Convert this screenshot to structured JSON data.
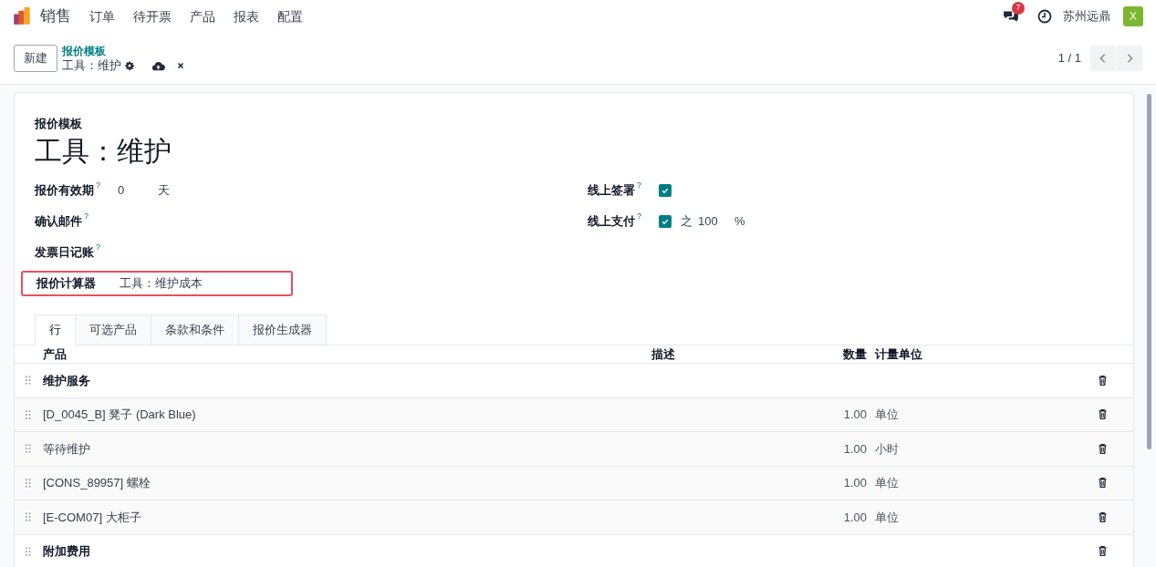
{
  "navbar": {
    "app": "销售",
    "menu": [
      "订单",
      "待开票",
      "产品",
      "报表",
      "配置"
    ],
    "message_count": "7",
    "company": "苏州远鼎",
    "avatar_letter": "X"
  },
  "control_panel": {
    "new_button": "新建",
    "breadcrumb": "报价模板",
    "record": "工具：维护",
    "pager": "1 / 1"
  },
  "form": {
    "caption": "报价模板",
    "title": "工具：维护",
    "left_fields": [
      {
        "label": "报价有效期",
        "help": "?",
        "value": "0",
        "unit": "天",
        "highlighted": false
      },
      {
        "label": "确认邮件",
        "help": "?",
        "highlighted": false
      },
      {
        "label": "发票日记账",
        "help": "?",
        "highlighted": false
      },
      {
        "label": "报价计算器",
        "value": "工具：维护成本",
        "highlighted": true
      }
    ],
    "right_fields": [
      {
        "label": "线上签署",
        "help": "?",
        "checked": true
      },
      {
        "label": "线上支付",
        "help": "?",
        "checked": true,
        "prefix": "之",
        "value": "100",
        "unit": "%"
      }
    ],
    "tabs": [
      {
        "label": "行",
        "selected": true
      },
      {
        "label": "可选产品",
        "selected": false
      },
      {
        "label": "条款和条件",
        "selected": false
      },
      {
        "label": "报价生成器",
        "selected": false
      }
    ],
    "table": {
      "columns": [
        "产品",
        "描述",
        "数量",
        "计量单位"
      ],
      "rows": [
        {
          "kind": "section",
          "product": "维护服务"
        },
        {
          "kind": "product",
          "product": "[D_0045_B] 凳子 (Dark Blue)",
          "quantity": "1.00",
          "uom": "单位"
        },
        {
          "kind": "product",
          "product": "等待维护",
          "quantity": "1.00",
          "uom": "小时"
        },
        {
          "kind": "product",
          "product": "[CONS_89957] 螺栓",
          "quantity": "1.00",
          "uom": "单位"
        },
        {
          "kind": "product",
          "product": "[E-COM07] 大柜子",
          "quantity": "1.00",
          "uom": "单位"
        },
        {
          "kind": "section",
          "product": "附加费用"
        }
      ]
    }
  }
}
